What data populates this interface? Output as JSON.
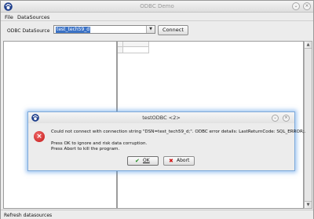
{
  "window": {
    "title": "ODBC Demo",
    "app_icon": "paw-icon"
  },
  "menu": {
    "items": [
      "File",
      "DataSources"
    ]
  },
  "datasource": {
    "label": "ODBC DataSource",
    "selected": "test_tech59_d",
    "dropdown_icon": "chevron-down-icon",
    "connect_label": "Connect"
  },
  "status": {
    "text": "Refresh datasources"
  },
  "dialog": {
    "title": "testODBC <2>",
    "icon": "error-icon",
    "message_lines": [
      "Could not connect with connection string \"DSN=test_tech59_d;\". ODBC error details: LastReturnCode: SQL_ERROR;.",
      "",
      "Press OK to ignore and risk data corruption.",
      "Press Abort to kill the program."
    ],
    "ok_label": "OK",
    "abort_label": "Abort",
    "ok_icon": "checkmark-icon",
    "abort_icon": "cross-icon"
  },
  "colors": {
    "accent": "#3b72c5",
    "error": "#c41818",
    "ok_icon": "#1f8a1f"
  }
}
